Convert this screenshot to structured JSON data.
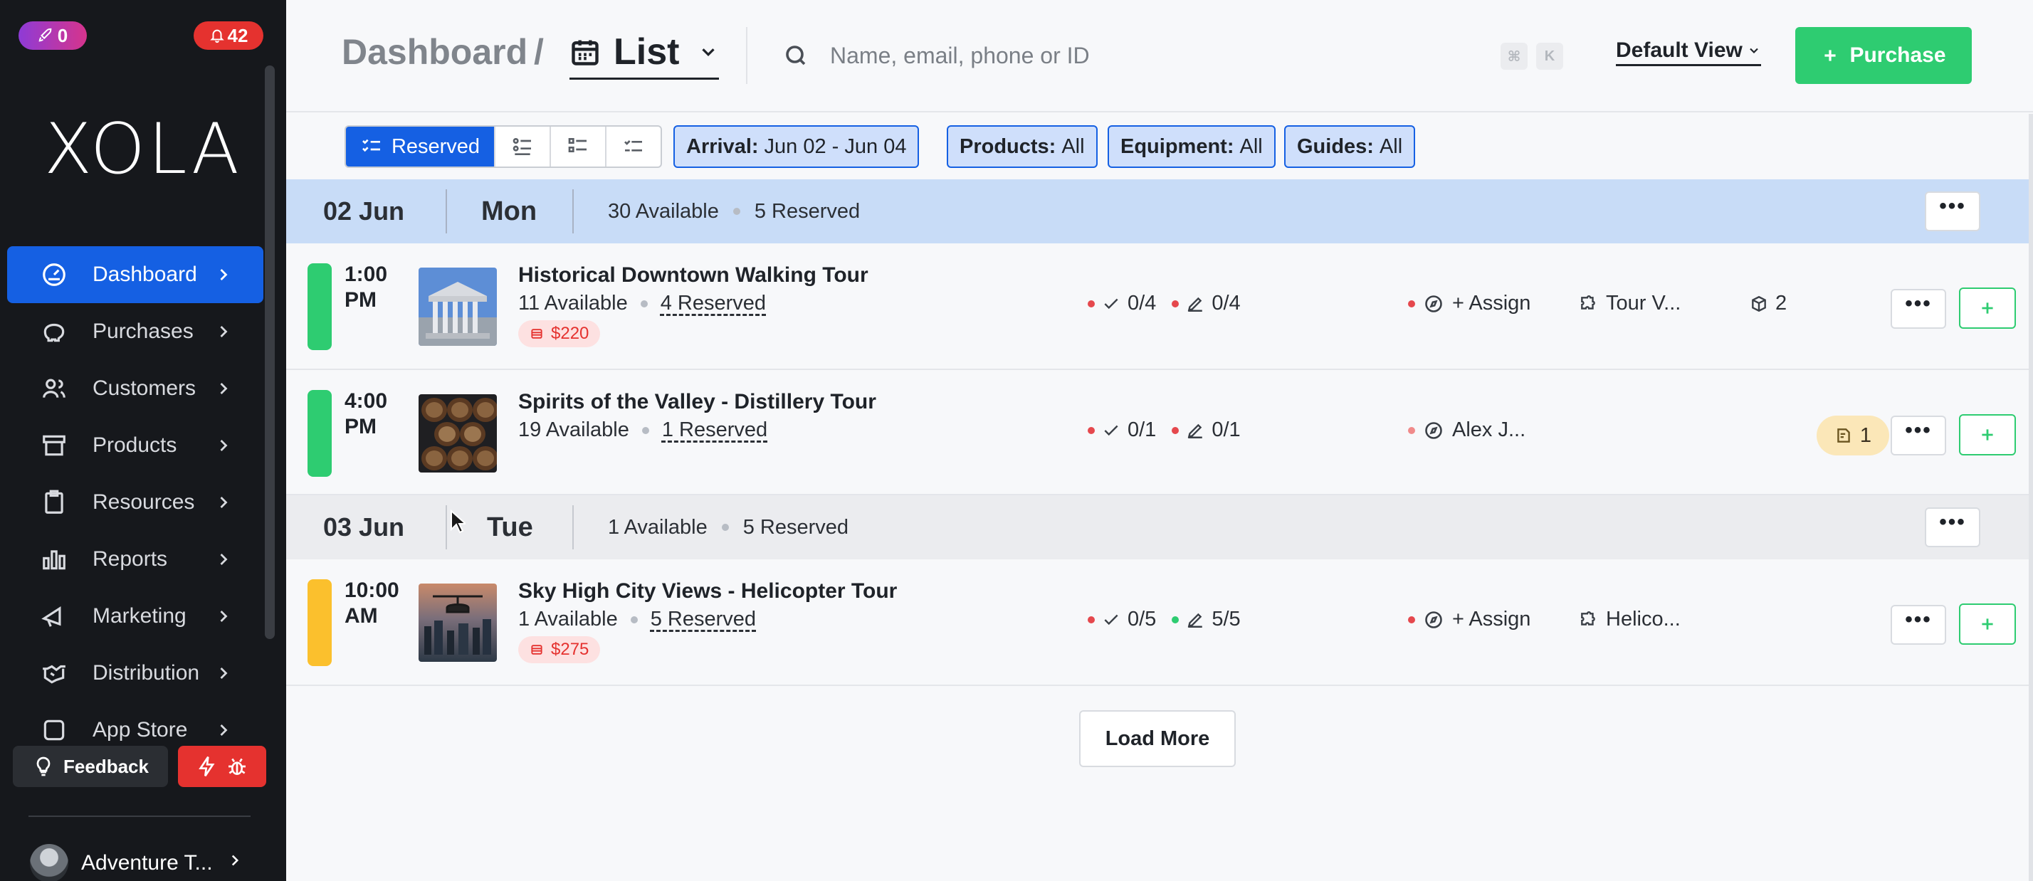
{
  "sidebar": {
    "badge_a": "0",
    "badge_b": "42",
    "logo": "XOLA",
    "nav": [
      {
        "label": "Dashboard",
        "icon": "gauge-icon",
        "active": true
      },
      {
        "label": "Purchases",
        "icon": "piggy-bank-icon"
      },
      {
        "label": "Customers",
        "icon": "users-icon"
      },
      {
        "label": "Products",
        "icon": "archive-box-icon"
      },
      {
        "label": "Resources",
        "icon": "clipboard-icon"
      },
      {
        "label": "Reports",
        "icon": "bar-chart-icon"
      },
      {
        "label": "Marketing",
        "icon": "megaphone-icon"
      },
      {
        "label": "Distribution",
        "icon": "handshake-icon"
      },
      {
        "label": "App Store",
        "icon": "square-icon"
      }
    ],
    "feedback_label": "Feedback",
    "user_name": "Adventure T..."
  },
  "header": {
    "breadcrumb_root": "Dashboard",
    "breadcrumb_sep": "/",
    "view_label": "List",
    "search_placeholder": "Name, email, phone or ID",
    "kbd_cmd": "⌘",
    "kbd_k": "K",
    "default_view": "Default View",
    "purchase_label": "Purchase"
  },
  "filters": {
    "reserved_label": "Reserved",
    "chips": [
      {
        "key": "Arrival:",
        "value": "Jun 02 - Jun 04"
      },
      {
        "key": "Products:",
        "value": "All"
      },
      {
        "key": "Equipment:",
        "value": "All"
      },
      {
        "key": "Guides:",
        "value": "All"
      }
    ]
  },
  "days": [
    {
      "date": "02 Jun",
      "dow": "Mon",
      "available": "30 Available",
      "reserved": "5 Reserved",
      "more": "•••",
      "bg": "#c8dcf7",
      "events": [
        {
          "time": "1:00 PM",
          "status_color": "#2ecc71",
          "title": "Historical Downtown Walking Tour",
          "available": "11 Available",
          "reserved": "4 Reserved",
          "price": "$220",
          "checkin": "0/4",
          "waiver": "0/4",
          "guide": "+ Assign",
          "equipment": "Tour V...",
          "boxes": "2"
        },
        {
          "time": "4:00 PM",
          "status_color": "#2ecc71",
          "title": "Spirits of the Valley - Distillery Tour",
          "available": "19 Available",
          "reserved": "1 Reserved",
          "checkin": "0/1",
          "waiver": "0/1",
          "guide": "Alex J...",
          "notes": "1"
        }
      ]
    },
    {
      "date": "03 Jun",
      "dow": "Tue",
      "available": "1 Available",
      "reserved": "5 Reserved",
      "more": "•••",
      "bg": "#ebecef",
      "events": [
        {
          "time": "10:00 AM",
          "status_color": "#fbc02d",
          "title": "Sky High City Views - Helicopter Tour",
          "available": "1 Available",
          "reserved": "5 Reserved",
          "price": "$275",
          "checkin": "0/5",
          "waiver": "5/5",
          "guide": "+ Assign",
          "equipment": "Helico..."
        }
      ]
    }
  ],
  "load_more": "Load More",
  "colors": {
    "accent": "#1560e3",
    "purchase": "#2ecc71",
    "danger": "#e5322f",
    "sidebar_bg": "#16181c"
  }
}
